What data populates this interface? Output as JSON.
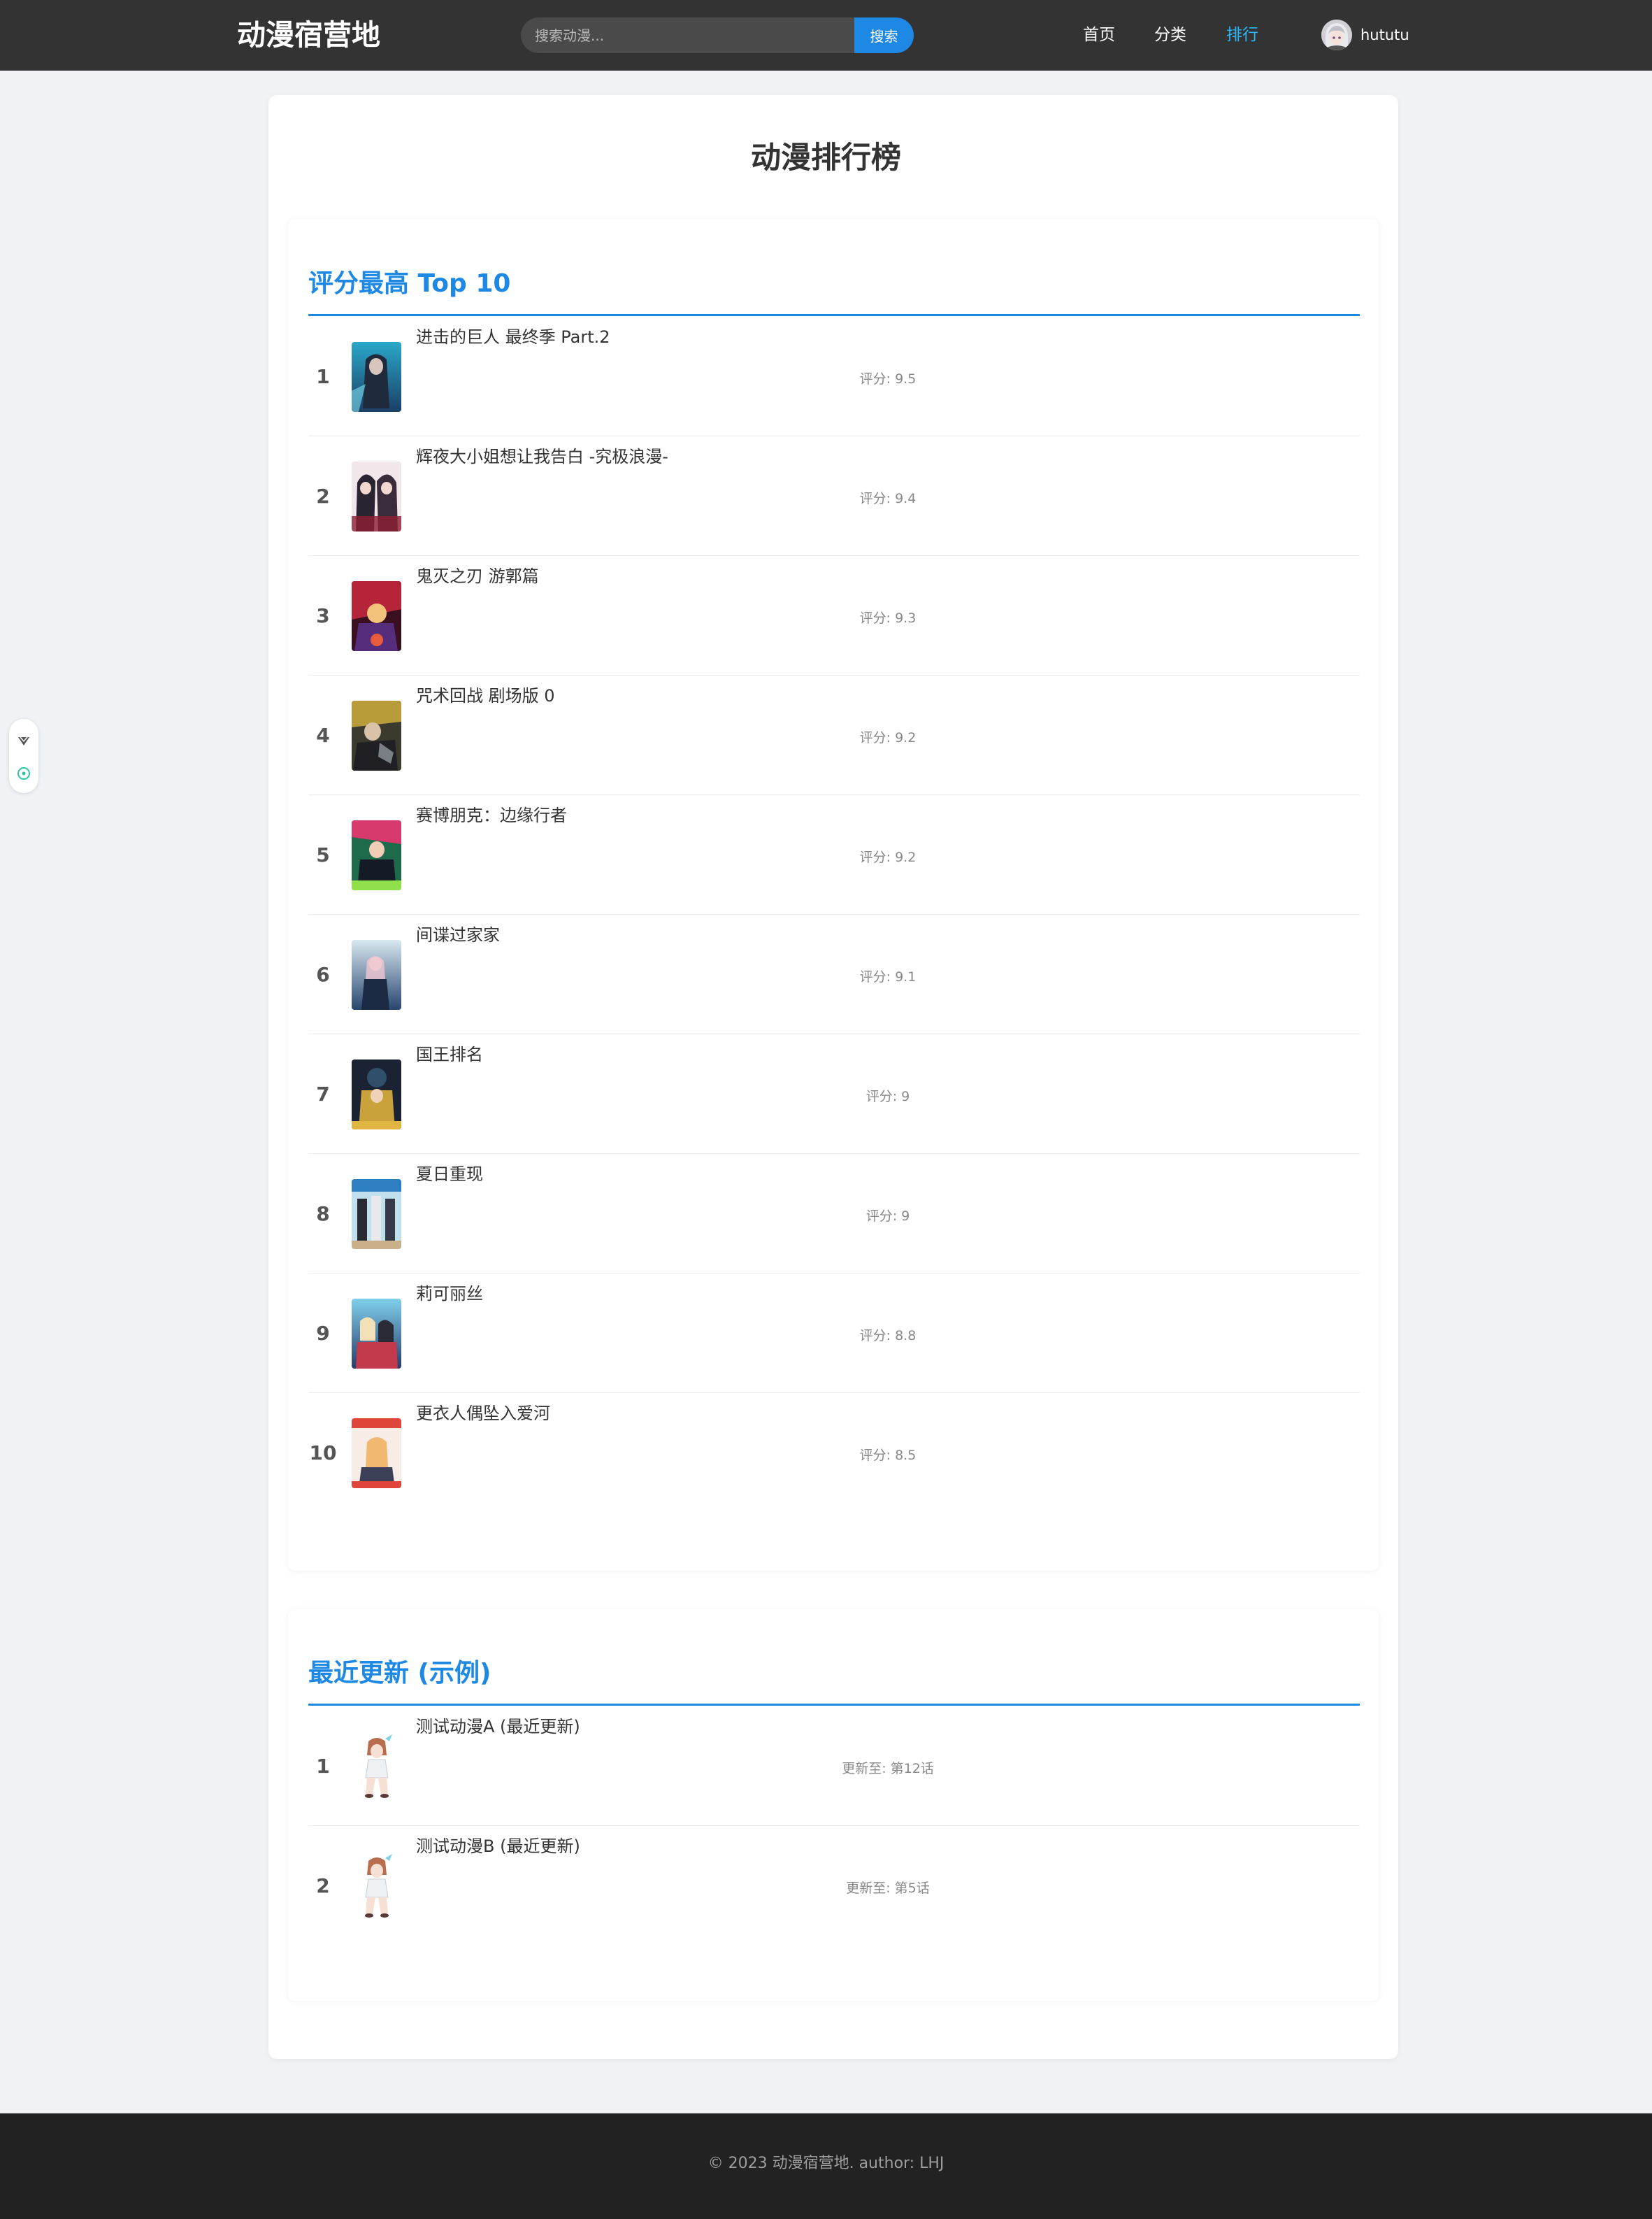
{
  "header": {
    "logo": "动漫宿营地",
    "search_placeholder": "搜索动漫...",
    "search_button": "搜索",
    "nav": [
      "首页",
      "分类",
      "排行"
    ],
    "active_nav": "排行",
    "username": "hututu"
  },
  "main": {
    "title": "动漫排行榜",
    "top_rated": {
      "title": "评分最高 Top 10",
      "items": [
        {
          "rank": "1",
          "title": "进击的巨人 最终季 Part.2",
          "meta": "评分: 9.5"
        },
        {
          "rank": "2",
          "title": "辉夜大小姐想让我告白 -究极浪漫-",
          "meta": "评分: 9.4"
        },
        {
          "rank": "3",
          "title": "鬼灭之刃 游郭篇",
          "meta": "评分: 9.3"
        },
        {
          "rank": "4",
          "title": "咒术回战 剧场版 0",
          "meta": "评分: 9.2"
        },
        {
          "rank": "5",
          "title": "赛博朋克：边缘行者",
          "meta": "评分: 9.2"
        },
        {
          "rank": "6",
          "title": "间谍过家家",
          "meta": "评分: 9.1"
        },
        {
          "rank": "7",
          "title": "国王排名",
          "meta": "评分: 9"
        },
        {
          "rank": "8",
          "title": "夏日重现",
          "meta": "评分: 9"
        },
        {
          "rank": "9",
          "title": "莉可丽丝",
          "meta": "评分: 8.8"
        },
        {
          "rank": "10",
          "title": "更衣人偶坠入爱河",
          "meta": "评分: 8.5"
        }
      ]
    },
    "recent": {
      "title": "最近更新 (示例)",
      "items": [
        {
          "rank": "1",
          "title": "测试动漫A (最近更新)",
          "meta": "更新至: 第12话"
        },
        {
          "rank": "2",
          "title": "测试动漫B (最近更新)",
          "meta": "更新至: 第5话"
        }
      ]
    }
  },
  "footer": {
    "text": "© 2023 动漫宿营地. author: LHJ"
  },
  "icons": {
    "side_widget": [
      "arrow-icon",
      "target-icon"
    ]
  },
  "colors": {
    "accent": "#1e88e5",
    "header_bg": "#333333",
    "footer_bg": "#222222",
    "active_nav": "#29b6f6"
  }
}
